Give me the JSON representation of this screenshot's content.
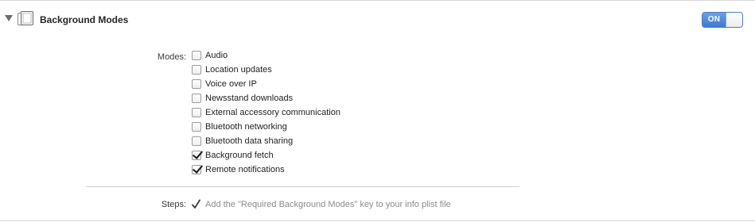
{
  "section": {
    "title": "Background Modes",
    "toggle_label": "ON",
    "icon": "capability-icon",
    "disclosure_icon": "disclosure-triangle-icon",
    "accent_color": "#3f79d3"
  },
  "modes": {
    "label": "Modes:",
    "items": [
      {
        "label": "Audio",
        "checked": false
      },
      {
        "label": "Location updates",
        "checked": false
      },
      {
        "label": "Voice over IP",
        "checked": false
      },
      {
        "label": "Newsstand downloads",
        "checked": false
      },
      {
        "label": "External accessory communication",
        "checked": false
      },
      {
        "label": "Bluetooth networking",
        "checked": false
      },
      {
        "label": "Bluetooth data sharing",
        "checked": false
      },
      {
        "label": "Background fetch",
        "checked": true
      },
      {
        "label": "Remote notifications",
        "checked": true
      }
    ]
  },
  "steps": {
    "label": "Steps:",
    "items": [
      {
        "text": "Add the \"Required Background Modes\" key to your info plist file",
        "icon": "checkmark-icon"
      }
    ]
  }
}
